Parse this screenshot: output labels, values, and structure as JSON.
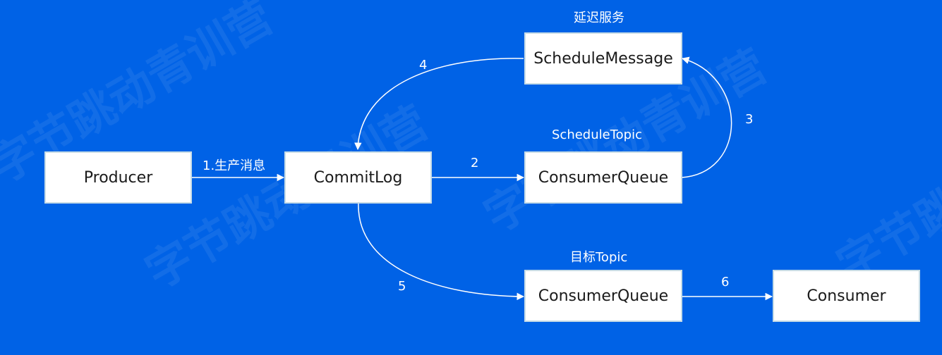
{
  "watermark": {
    "text": "字节跳动青训营",
    "color": "#ffffff"
  },
  "colors": {
    "background": "#0062e6",
    "box_fill": "#ffffff",
    "box_border": "#c7dce6",
    "arrow": "#ffffff"
  },
  "nodes": {
    "producer": "Producer",
    "commitlog": "CommitLog",
    "schedule_message": "ScheduleMessage",
    "schedule_queue": "ConsumerQueue",
    "target_queue": "ConsumerQueue",
    "consumer": "Consumer"
  },
  "group_labels": {
    "delay_service": "延迟服务",
    "schedule_topic": "ScheduleTopic",
    "target_topic": "目标Topic"
  },
  "edge_labels": {
    "step1": "1.生产消息",
    "step2": "2",
    "step3": "3",
    "step4": "4",
    "step5": "5",
    "step6": "6"
  }
}
